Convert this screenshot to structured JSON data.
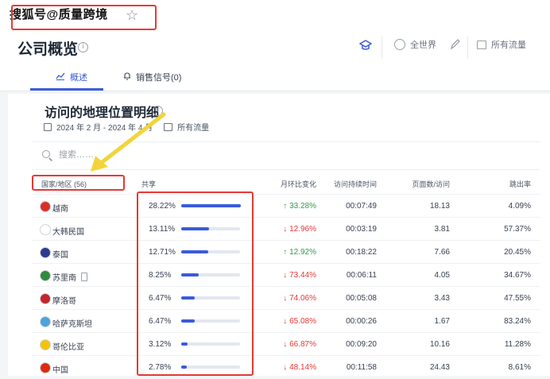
{
  "watermark": "搜狐号@质量跨境",
  "page_title": "公司概览",
  "header_buttons": {
    "region": "全世界",
    "traffic": "所有流量"
  },
  "tabs": [
    {
      "label": "概述"
    },
    {
      "label": "销售信号(0)"
    }
  ],
  "card": {
    "title": "访问的地理位置明细",
    "date_range": "2024 年 2 月 - 2024 年 4 月",
    "traffic_label": "所有流量"
  },
  "search": {
    "placeholder": "搜索……"
  },
  "columns": {
    "country": "国家/地区 (56)",
    "share": "共享",
    "mom": "月环比变化",
    "duration": "访问持续时间",
    "pages": "页面数/访问",
    "bounce": "跳出率"
  },
  "rows": [
    {
      "country": "越南",
      "share": "28.22%",
      "share_value": 28.22,
      "mom": "↑ 33.28%",
      "trend": "up",
      "duration": "00:07:49",
      "pages": "18.13",
      "bounce": "4.09%",
      "flag_color": "#d93025"
    },
    {
      "country": "大韩民国",
      "share": "13.11%",
      "share_value": 13.11,
      "mom": "↓ 12.96%",
      "trend": "down",
      "duration": "00:03:19",
      "pages": "3.81",
      "bounce": "57.37%",
      "flag_color": "#ffffff"
    },
    {
      "country": "泰国",
      "share": "12.71%",
      "share_value": 12.71,
      "mom": "↑ 12.92%",
      "trend": "up",
      "duration": "00:18:22",
      "pages": "7.66",
      "bounce": "20.45%",
      "flag_color": "#2d3b8f"
    },
    {
      "country": "苏里南",
      "share": "8.25%",
      "share_value": 8.25,
      "mom": "↓ 73.44%",
      "trend": "down",
      "duration": "00:06:11",
      "pages": "4.05",
      "bounce": "34.67%",
      "flag_color": "#2e8b3c",
      "device": true
    },
    {
      "country": "摩洛哥",
      "share": "6.47%",
      "share_value": 6.47,
      "mom": "↓ 74.06%",
      "trend": "down",
      "duration": "00:05:08",
      "pages": "3.43",
      "bounce": "47.55%",
      "flag_color": "#c1272d"
    },
    {
      "country": "哈萨克斯坦",
      "share": "6.47%",
      "share_value": 6.47,
      "mom": "↓ 65.08%",
      "trend": "down",
      "duration": "00:00:26",
      "pages": "1.67",
      "bounce": "83.24%",
      "flag_color": "#4aa3df"
    },
    {
      "country": "哥伦比亚",
      "share": "3.12%",
      "share_value": 3.12,
      "mom": "↓ 66.87%",
      "trend": "down",
      "duration": "00:09:20",
      "pages": "10.16",
      "bounce": "11.28%",
      "flag_color": "#f4c20d"
    },
    {
      "country": "中国",
      "share": "2.78%",
      "share_value": 2.78,
      "mom": "↓ 48.14%",
      "trend": "down",
      "duration": "00:11:58",
      "pages": "24.43",
      "bounce": "8.61%",
      "flag_color": "#de2910"
    }
  ],
  "colors": {
    "accent": "#3b5bdb",
    "up": "#2e9e4b",
    "down": "#e53935",
    "highlight": "#e53935",
    "arrow": "#f2d43a"
  }
}
